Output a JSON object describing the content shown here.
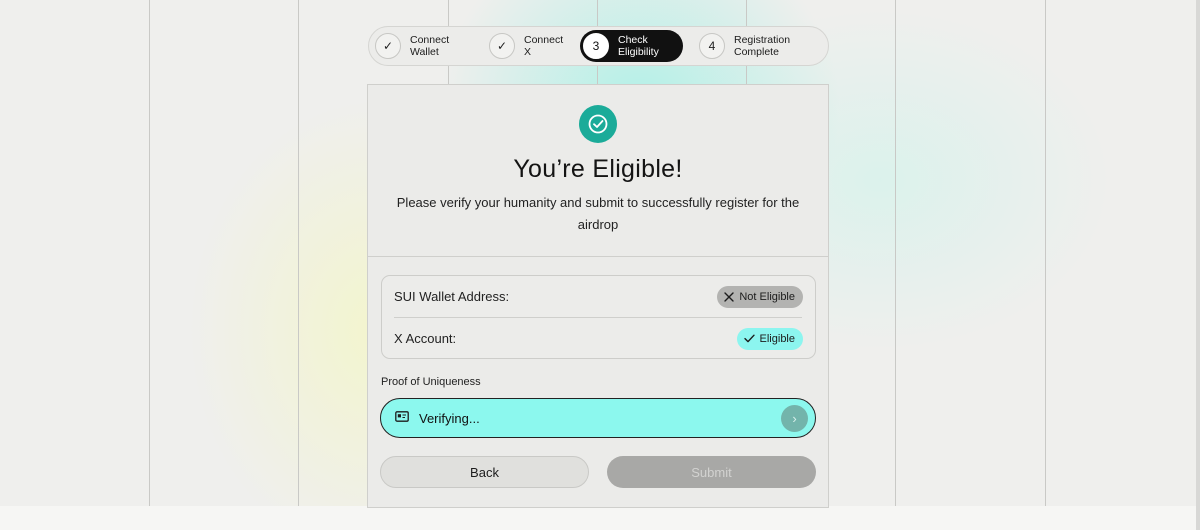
{
  "stepper": {
    "steps": [
      {
        "marker": "✓",
        "label": "Connect Wallet",
        "state": "done"
      },
      {
        "marker": "✓",
        "label": "Connect X",
        "state": "done"
      },
      {
        "marker": "3",
        "label": "Check Eligibility",
        "state": "active"
      },
      {
        "marker": "4",
        "label": "Registration Complete",
        "state": "pending"
      }
    ]
  },
  "card": {
    "title": "You’re Eligible!",
    "subtitle": "Please verify your humanity and submit to successfully register for the airdrop",
    "status": {
      "wallet_label": "SUI Wallet Address:",
      "wallet_status": "Not Eligible",
      "x_label": "X Account:",
      "x_status": "Eligible"
    },
    "proof": {
      "label": "Proof of Uniqueness",
      "status_text": "Verifying..."
    },
    "buttons": {
      "back": "Back",
      "submit": "Submit"
    }
  },
  "colors": {
    "accent_teal": "#1bab99",
    "eligible_cyan": "#8cf5ef",
    "verify_bar": "#8cf8ee",
    "not_eligible_gray": "#b3b3b1",
    "active_step": "#111111"
  },
  "icons": {
    "success": "check-circle-icon",
    "not_eligible": "x-icon",
    "eligible": "check-icon",
    "proof": "id-card-icon",
    "go": "chevron-right-icon"
  }
}
